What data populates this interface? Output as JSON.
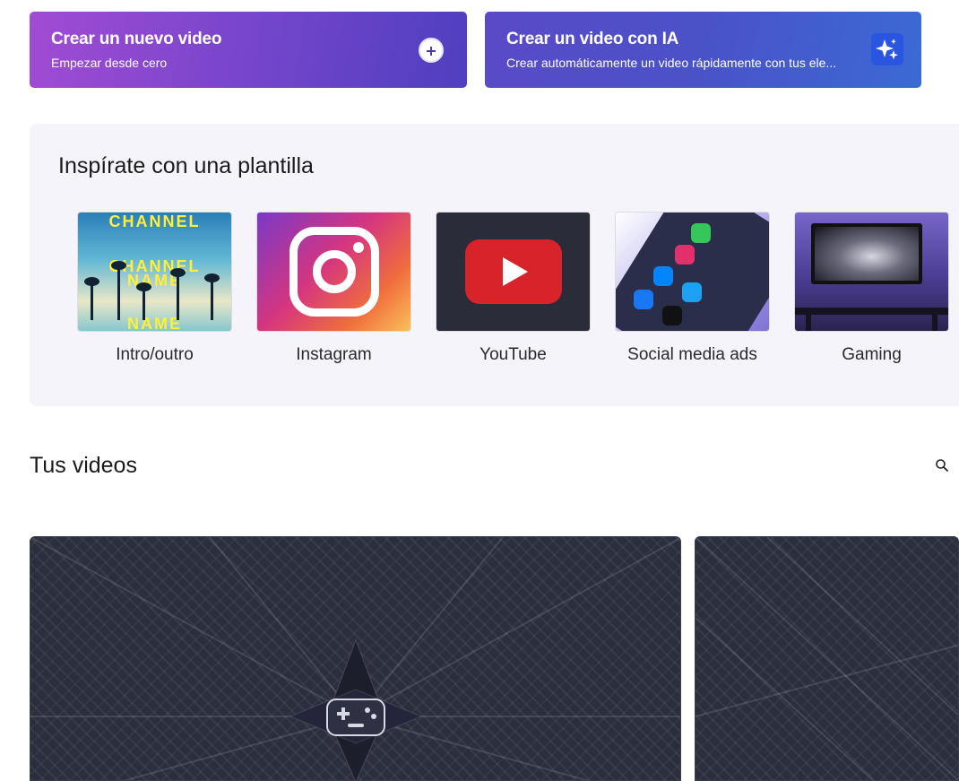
{
  "hero": {
    "new_video": {
      "title": "Crear un nuevo video",
      "subtitle": "Empezar desde cero",
      "icon": "plus-circle-icon"
    },
    "ai_video": {
      "title": "Crear un video con IA",
      "subtitle": "Crear automáticamente un video rápidamente con tus ele...",
      "icon": "sparkle-icon"
    }
  },
  "templates": {
    "heading": "Inspírate con una plantilla",
    "items": [
      {
        "label": "Intro/outro",
        "thumb_text": [
          "CHANNEL",
          "CHANNEL",
          "NAME",
          "NAME"
        ]
      },
      {
        "label": "Instagram"
      },
      {
        "label": "YouTube"
      },
      {
        "label": "Social media ads"
      },
      {
        "label": "Gaming"
      }
    ]
  },
  "videos": {
    "heading": "Tus videos",
    "search_icon": "search-icon"
  },
  "colors": {
    "hero_new_gradient": [
      "#a24bd4",
      "#4f3fc0"
    ],
    "hero_ai_gradient": [
      "#5a4ac8",
      "#3b6ad4"
    ],
    "template_panel_bg": "#f5f4fb",
    "video_card_bg": "#2b2e3d"
  }
}
